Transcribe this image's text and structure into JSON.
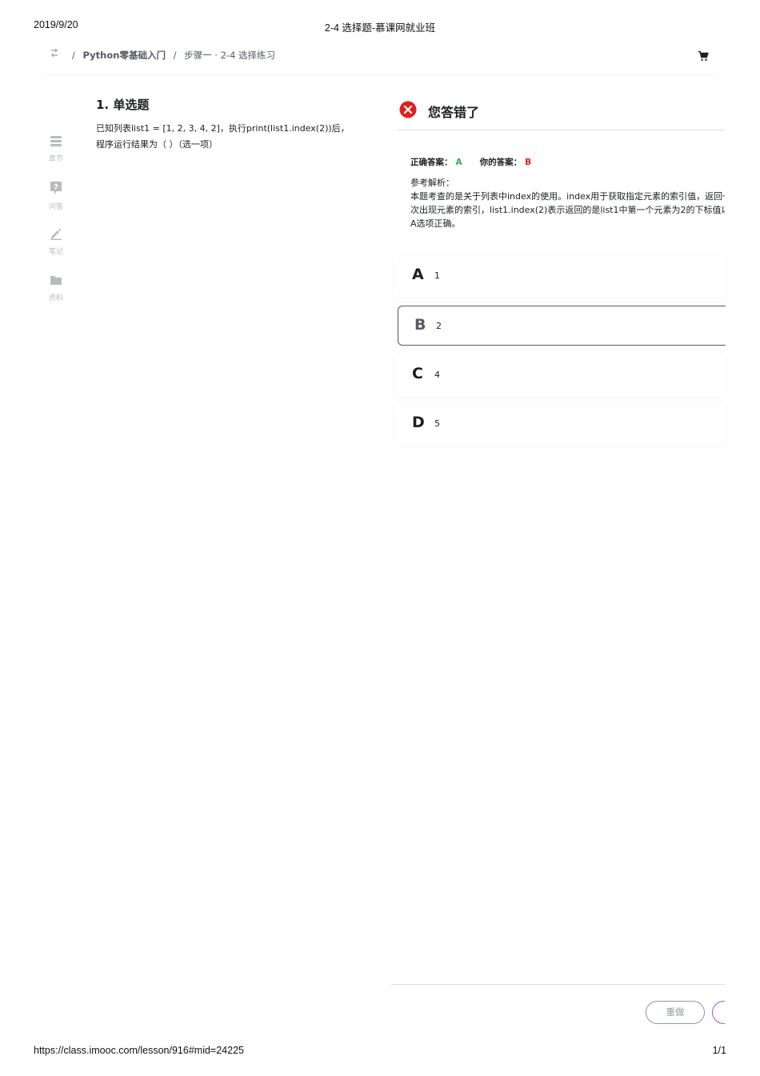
{
  "print_header": {
    "date": "2019/9/20",
    "title": "2-4 选择题-慕课网就业班"
  },
  "breadcrumb": {
    "course": "Python零基础入门",
    "step": "步骤一 · 2-4 选择练习"
  },
  "sidebar": {
    "items": [
      {
        "label": "章节",
        "icon": "chapter-list-icon"
      },
      {
        "label": "问答",
        "icon": "question-icon"
      },
      {
        "label": "笔记",
        "icon": "pencil-icon"
      },
      {
        "label": "资料",
        "icon": "folder-icon"
      }
    ]
  },
  "question": {
    "title": "1. 单选题",
    "text": "已知列表list1 = [1, 2, 3, 4, 2]，执行print(list1.index(2))后，程序运行结果为（ ）（选一项）"
  },
  "result": {
    "title": "您答错了",
    "correct_label": "正确答案：",
    "correct_value": "A",
    "yours_label": "你的答案：",
    "yours_value": "B",
    "analysis_label": "参考解析：",
    "analysis_text": "本题考查的是关于列表中index的使用。index用于获取指定元素的索引值，返回一次出现元素的索引，list1.index(2)表示返回的是list1中第一个元素为2的下标值以A选项正确。"
  },
  "options": [
    {
      "letter": "A",
      "value": "1",
      "selected": false
    },
    {
      "letter": "B",
      "value": "2",
      "selected": true
    },
    {
      "letter": "C",
      "value": "4",
      "selected": false
    },
    {
      "letter": "D",
      "value": "5",
      "selected": false
    }
  ],
  "footer": {
    "redo_label": "重做"
  },
  "print_footer": {
    "url": "https://class.imooc.com/lesson/916#mid=24225",
    "pages": "1/1"
  },
  "colors": {
    "correct": "#2dac59",
    "wrong": "#e02020",
    "next_outline": "#9b59d6"
  }
}
